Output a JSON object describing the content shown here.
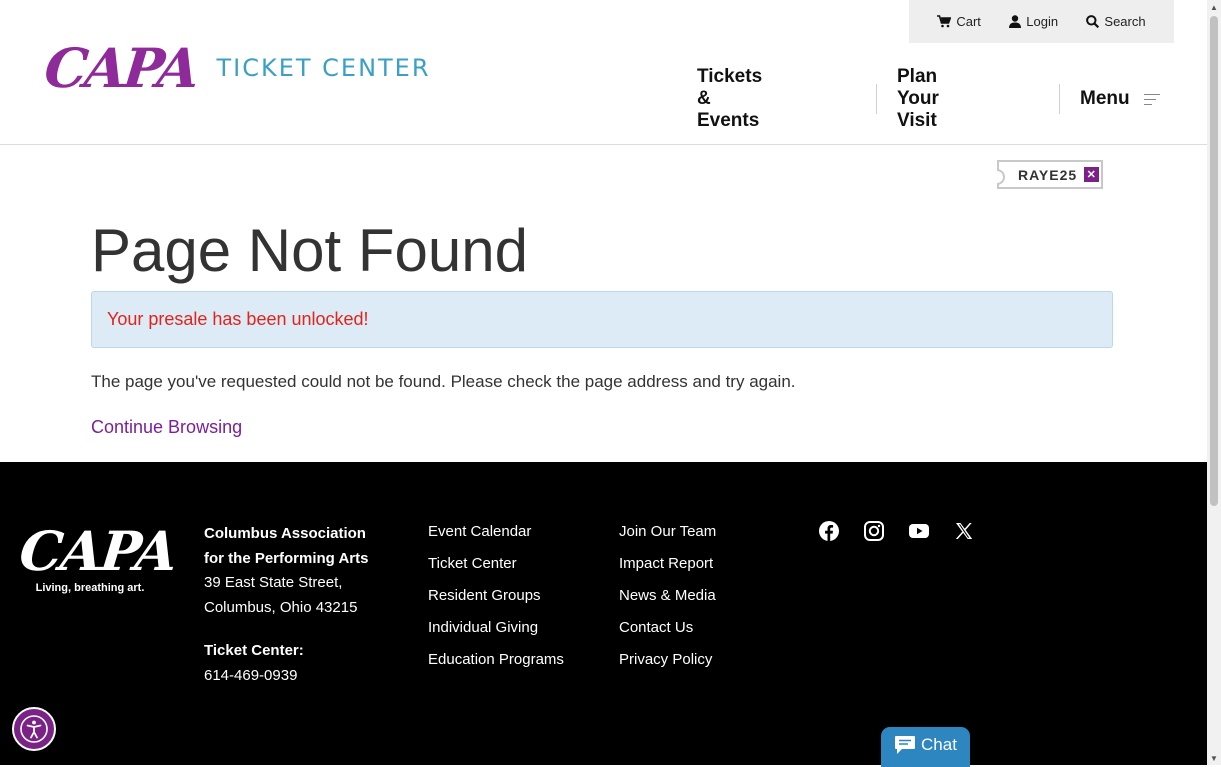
{
  "header": {
    "logo_text": "CAPA",
    "logo_subtitle": "TICKET CENTER",
    "utility": {
      "cart": "Cart",
      "login": "Login",
      "search": "Search"
    },
    "nav": {
      "tickets": "Tickets & Events",
      "plan": "Plan Your Visit",
      "menu": "Menu"
    }
  },
  "promo": {
    "code": "RAYE25",
    "remove_icon": "close-icon"
  },
  "main": {
    "title": "Page Not Found",
    "alert": "Your presale has been unlocked!",
    "message": "The page you've requested could not be found. Please check the page address and try again.",
    "continue_link": "Continue Browsing"
  },
  "footer": {
    "logo_text": "CAPA",
    "logo_tagline": "Living, breathing art.",
    "org_line1": "Columbus Association",
    "org_line2": "for the Performing Arts",
    "street": "39 East State Street,",
    "city": "Columbus, Ohio 43215",
    "ticket_label": "Ticket Center:",
    "phone": "614-469-0939",
    "col1": [
      "Event Calendar",
      "Ticket Center",
      "Resident Groups",
      "Individual Giving",
      "Education Programs"
    ],
    "col2": [
      "Join Our Team",
      "Impact Report",
      "News & Media",
      "Contact Us",
      "Privacy Policy"
    ],
    "social": [
      "facebook-icon",
      "instagram-icon",
      "youtube-icon",
      "x-icon"
    ],
    "chat_label": "Chat"
  },
  "colors": {
    "brand_purple": "#8e2a9a",
    "brand_blue": "#3aa0c6",
    "alert_bg": "#dcebf6",
    "alert_text": "#e0241b",
    "link": "#7a1fa0",
    "chat_bg": "#2e86c1"
  }
}
